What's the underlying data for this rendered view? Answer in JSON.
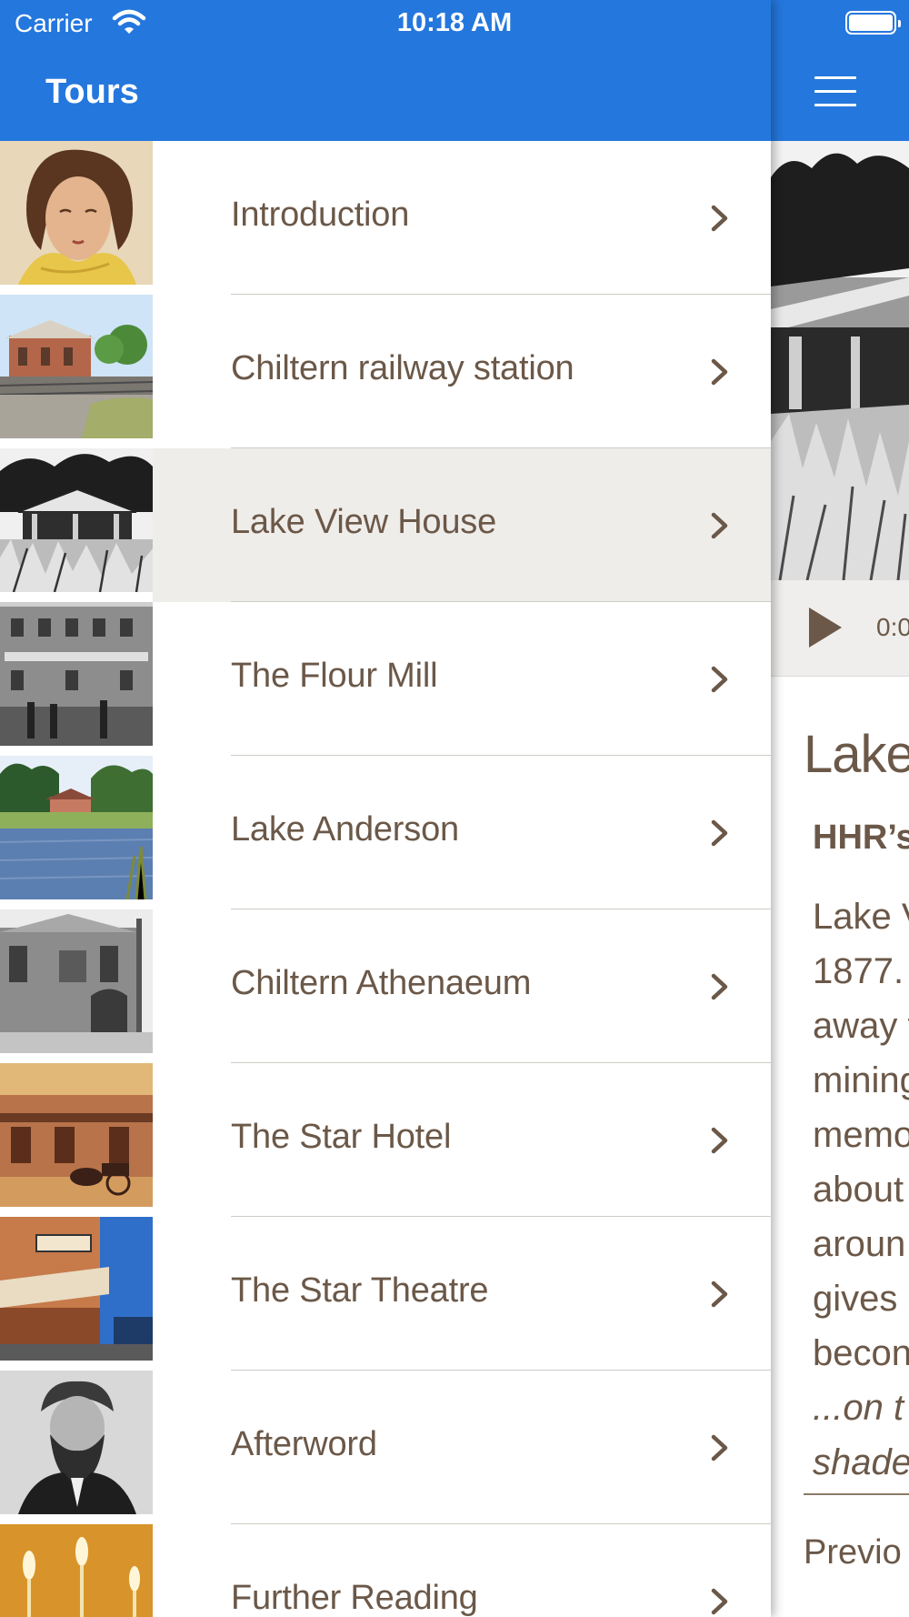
{
  "status_bar": {
    "carrier": "Carrier",
    "time": "10:18 AM"
  },
  "menu": {
    "title": "Tours",
    "items": [
      {
        "label": "Introduction",
        "thumbnail": "portrait-woman-yellow-scarf",
        "selected": false
      },
      {
        "label": "Chiltern railway station",
        "thumbnail": "railway-station-photo",
        "selected": false
      },
      {
        "label": "Lake View House",
        "thumbnail": "lake-view-house-bw-photo",
        "selected": true
      },
      {
        "label": "The Flour Mill",
        "thumbnail": "flour-mill-bw-photo",
        "selected": false
      },
      {
        "label": "Lake Anderson",
        "thumbnail": "lake-anderson-photo",
        "selected": false
      },
      {
        "label": "Chiltern Athenaeum",
        "thumbnail": "athenaeum-bw-photo",
        "selected": false
      },
      {
        "label": "The Star Hotel",
        "thumbnail": "star-hotel-sepia-photo",
        "selected": false
      },
      {
        "label": "The Star Theatre",
        "thumbnail": "star-theatre-photo",
        "selected": false
      },
      {
        "label": "Afterword",
        "thumbnail": "bearded-man-portrait",
        "selected": false
      },
      {
        "label": "Further Reading",
        "thumbnail": "candles-photo",
        "selected": false
      }
    ]
  },
  "detail": {
    "audio_time": "0:0",
    "title": "Lake",
    "subtitle": "HHR’s",
    "body_lines": [
      "Lake V",
      "1877.",
      "away t",
      "mining",
      "memo",
      "about",
      "aroun",
      "gives",
      "becon"
    ],
    "italic_lines": [
      "...on t",
      "shade"
    ],
    "previous_label": "Previo"
  },
  "colors": {
    "header_blue": "#2477dd",
    "text_brown": "#6b5848",
    "selected_row": "#efedea",
    "divider": "#cfcbc6"
  },
  "icons": {
    "wifi": "wifi-icon",
    "battery": "battery-icon",
    "menu": "hamburger-menu-icon",
    "chevron": "chevron-right-icon",
    "play": "play-icon"
  }
}
